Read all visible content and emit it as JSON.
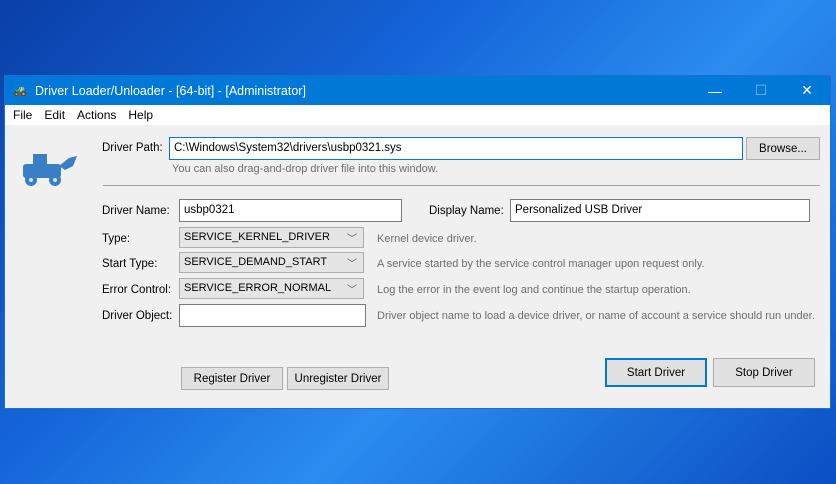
{
  "window": {
    "title": "Driver Loader/Unloader - [64-bit] - [Administrator]",
    "minimize": "—",
    "maximize": "☐",
    "close": "✕"
  },
  "menu": [
    "File",
    "Edit",
    "Actions",
    "Help"
  ],
  "form": {
    "driver_path_label": "Driver Path:",
    "driver_path": "C:\\Windows\\System32\\drivers\\usbp0321.sys",
    "browse": "Browse...",
    "drag_hint": "You can also drag-and-drop driver file into this window.",
    "driver_name_label": "Driver Name:",
    "driver_name": "usbp0321",
    "display_name_label": "Display Name:",
    "display_name": "Personalized USB Driver",
    "type_label": "Type:",
    "type": "SERVICE_KERNEL_DRIVER",
    "type_hint": "Kernel device driver.",
    "start_type_label": "Start Type:",
    "start_type": "SERVICE_DEMAND_START",
    "start_type_hint": "A service started by the service control manager upon request only.",
    "error_control_label": "Error Control:",
    "error_control": "SERVICE_ERROR_NORMAL",
    "error_control_hint": "Log the error in the event log and continue the startup operation.",
    "driver_object_label": "Driver Object:",
    "driver_object": "",
    "driver_object_hint": "Driver object name to load a device driver, or name of account a service should run under."
  },
  "buttons": {
    "register": "Register Driver",
    "unregister": "Unregister Driver",
    "start": "Start Driver",
    "stop": "Stop Driver"
  },
  "colors": {
    "accent": "#0078d7",
    "icon": "#3a7fc4"
  }
}
